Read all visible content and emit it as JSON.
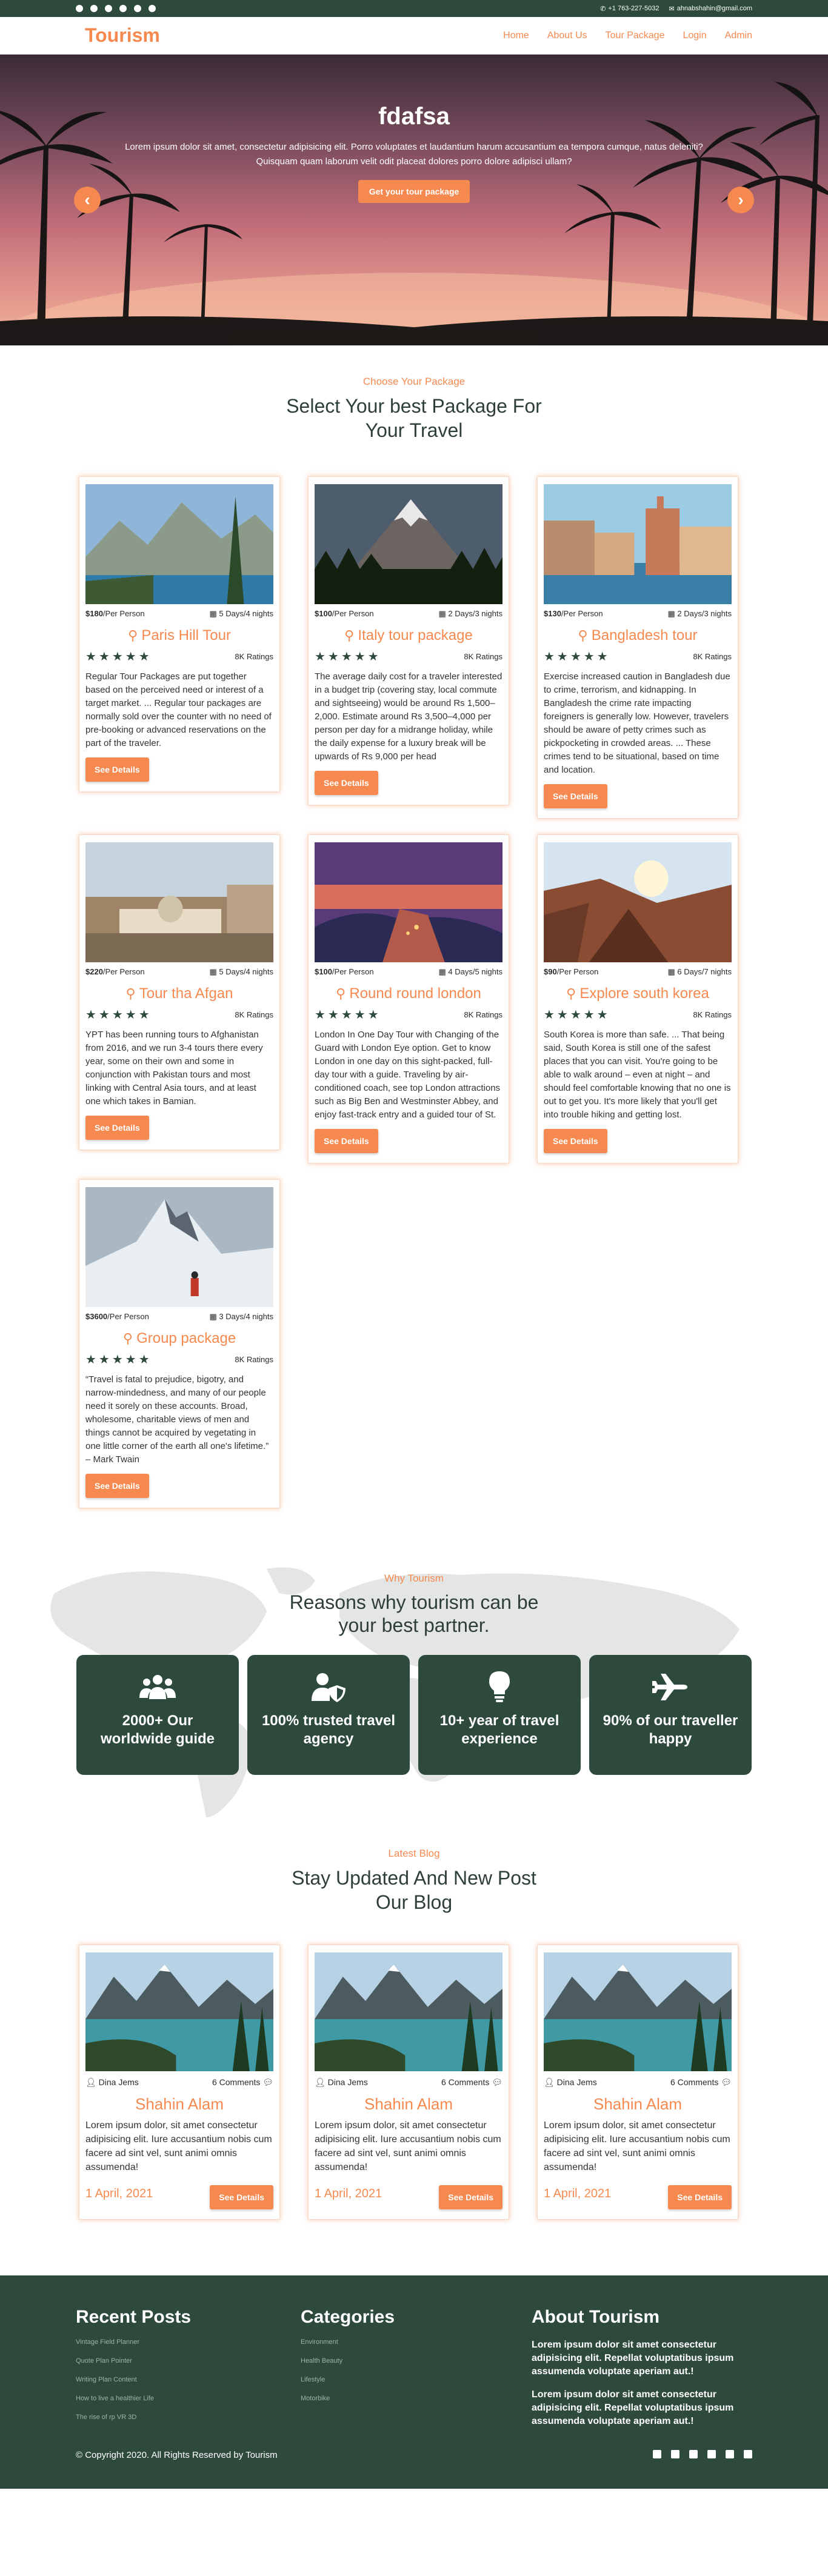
{
  "topbar": {
    "social_icons": [
      "google-icon",
      "facebook-icon",
      "twitter-icon",
      "youtube-icon",
      "whatsapp-icon",
      "instagram-icon"
    ],
    "phone": "+1 763-227-5032",
    "email": "ahnabshahin@gmail.com"
  },
  "nav": {
    "brand": "Tourism",
    "links": [
      "Home",
      "About Us",
      "Tour Package",
      "Login",
      "Admin"
    ]
  },
  "hero": {
    "title": "fdafsa",
    "text": "Lorem ipsum dolor sit amet, consectetur adipisicing elit. Porro voluptates et laudantium harum accusantium ea tempora cumque, natus deleniti? Quisquam quam laborum velit odit placeat dolores porro dolore adipisci ullam?",
    "cta": "Get your tour package",
    "prev": "‹",
    "next": "›"
  },
  "packages": {
    "kicker": "Choose Your Package",
    "heading_line1": "Select Your best Package For",
    "heading_line2": "Your Travel",
    "items": [
      {
        "price": "$180",
        "per": "/Per Person",
        "duration": "5 Days/4 nights",
        "title": "Paris Hill Tour",
        "stars": "★★★★★",
        "ratings": "8K Ratings",
        "desc": "Regular Tour Packages are put together based on the perceived need or interest of a target market. ... Regular tour packages are normally sold over the counter with no need of pre-booking or advanced reservations on the part of the traveler.",
        "button": "See Details"
      },
      {
        "price": "$100",
        "per": "/Per Person",
        "duration": "2 Days/3 nights",
        "title": "Italy tour package",
        "stars": "★★★★★",
        "ratings": "8K Ratings",
        "desc": "The average daily cost for a traveler interested in a budget trip (covering stay, local commute and sightseeing) would be around Rs 1,500–2,000. Estimate around Rs 3,500–4,000 per person per day for a midrange holiday, while the daily expense for a luxury break will be upwards of Rs 9,000 per head",
        "button": "See Details"
      },
      {
        "price": "$130",
        "per": "/Per Person",
        "duration": "2 Days/3 nights",
        "title": "Bangladesh tour",
        "stars": "★★★★★",
        "ratings": "8K Ratings",
        "desc": "Exercise increased caution in Bangladesh due to crime, terrorism, and kidnapping. In Bangladesh the crime rate impacting foreigners is generally low. However, travelers should be aware of petty crimes such as pickpocketing in crowded areas. ... These crimes tend to be situational, based on time and location.",
        "button": "See Details"
      },
      {
        "price": "$220",
        "per": "/Per Person",
        "duration": "5 Days/4 nights",
        "title": "Tour tha Afgan",
        "stars": "★★★★★",
        "ratings": "8K Ratings",
        "desc": "YPT has been running tours to Afghanistan from 2016, and we run 3-4 tours there every year, some on their own and some in conjunction with Pakistan tours and most linking with Central Asia tours, and at least one which takes in Bamian.",
        "button": "See Details"
      },
      {
        "price": "$100",
        "per": "/Per Person",
        "duration": "4 Days/5 nights",
        "title": "Round round london",
        "stars": "★★★★★",
        "ratings": "8K Ratings",
        "desc": "London In One Day Tour with Changing of the Guard with London Eye option. Get to know London in one day on this sight-packed, full-day tour with a guide. Traveling by air-conditioned coach, see top London attractions such as Big Ben and Westminster Abbey, and enjoy fast-track entry and a guided tour of St.",
        "button": "See Details"
      },
      {
        "price": "$90",
        "per": "/Per Person",
        "duration": "6 Days/7 nights",
        "title": "Explore south korea",
        "stars": "★★★★★",
        "ratings": "8K Ratings",
        "desc": "South Korea is more than safe. ... That being said, South Korea is still one of the safest places that you can visit. You're going to be able to walk around – even at night – and should feel comfortable knowing that no one is out to get you. It's more likely that you'll get into trouble hiking and getting lost.",
        "button": "See Details"
      },
      {
        "price": "$3600",
        "per": "/Per Person",
        "duration": "3 Days/4 nights",
        "title": "Group package",
        "stars": "★★★★★",
        "ratings": "8K Ratings",
        "desc": "“Travel is fatal to prejudice, bigotry, and narrow-mindedness, and many of our people need it sorely on these accounts. Broad, wholesome, charitable views of men and things cannot be acquired by vegetating in one little corner of the earth all one's lifetime.” – Mark Twain",
        "button": "See Details"
      }
    ]
  },
  "why": {
    "kicker": "Why Tourism",
    "heading_line1": "Reasons why tourism can be",
    "heading_line2": "your best partner.",
    "items": [
      {
        "icon": "users-icon",
        "line1": "2000+ Our",
        "line2": "worldwide guide"
      },
      {
        "icon": "shield-user-icon",
        "line1": "100% trusted travel",
        "line2": "agency"
      },
      {
        "icon": "lightbulb-icon",
        "line1": "10+ year of travel",
        "line2": "experience"
      },
      {
        "icon": "airplane-icon",
        "line1": "90% of our traveller",
        "line2": "happy"
      }
    ]
  },
  "blog": {
    "kicker": "Latest Blog",
    "heading_line1": "Stay Updated And New Post",
    "heading_line2": "Our Blog",
    "posts": [
      {
        "author": "Dina Jems",
        "comments": "6 Comments",
        "title": "Shahin Alam",
        "desc": "Lorem ipsum dolor, sit amet consectetur adipisicing elit. Iure accusantium nobis cum facere ad sint vel, sunt animi omnis assumenda!",
        "date": "1 April, 2021",
        "button": "See Details"
      },
      {
        "author": "Dina Jems",
        "comments": "6 Comments",
        "title": "Shahin Alam",
        "desc": "Lorem ipsum dolor, sit amet consectetur adipisicing elit. Iure accusantium nobis cum facere ad sint vel, sunt animi omnis assumenda!",
        "date": "1 April, 2021",
        "button": "See Details"
      },
      {
        "author": "Dina Jems",
        "comments": "6 Comments",
        "title": "Shahin Alam",
        "desc": "Lorem ipsum dolor, sit amet consectetur adipisicing elit. Iure accusantium nobis cum facere ad sint vel, sunt animi omnis assumenda!",
        "date": "1 April, 2021",
        "button": "See Details"
      }
    ]
  },
  "footer": {
    "recent_title": "Recent Posts",
    "recent": [
      "Vintage Field Planner",
      "Quote Plan Pointer",
      "Writing Plan Content",
      "How to live a healthier Life",
      "The rise of rp VR 3D"
    ],
    "categories_title": "Categories",
    "categories": [
      "Environment",
      "Health Beauty",
      "Lifestyle",
      "Motorbike"
    ],
    "about_title": "About Tourism",
    "about_p1": "Lorem ipsum dolor sit amet consectetur adipisicing elit. Repellat voluptatibus ipsum assumenda voluptate aperiam aut.!",
    "about_p2": "Lorem ipsum dolor sit amet consectetur adipisicing elit. Repellat voluptatibus ipsum assumenda voluptate aperiam aut.!",
    "copyright": "© Copyright 2020. All Rights Reserved by Tourism",
    "social_icons": [
      "instagram-icon",
      "facebook-icon",
      "messenger-icon",
      "linkedin-icon",
      "youtube-icon",
      "twitter-icon"
    ]
  },
  "colors": {
    "accent": "#f5894f",
    "dark": "#2e4a3d"
  }
}
